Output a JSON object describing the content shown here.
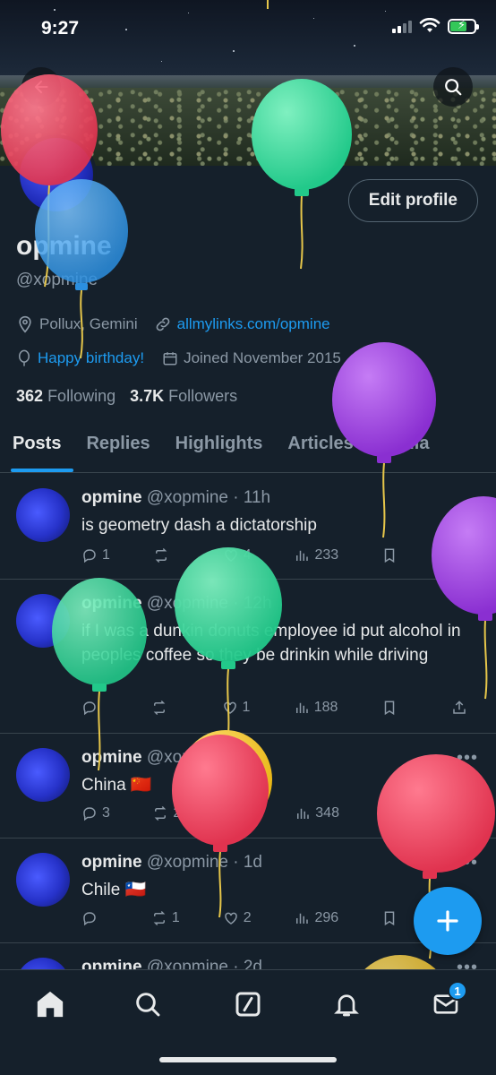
{
  "status_bar": {
    "time": "9:27"
  },
  "profile": {
    "display_name": "opmine",
    "handle": "@xopmine",
    "location": "Pollux, Gemini",
    "website": "allmylinks.com/opmine",
    "birthday": "Happy birthday!",
    "joined": "Joined November 2015",
    "following_count": "362",
    "following_label": "Following",
    "followers_count": "3.7K",
    "followers_label": "Followers",
    "edit_label": "Edit profile"
  },
  "tabs": [
    "Posts",
    "Replies",
    "Highlights",
    "Articles",
    "Media"
  ],
  "tweets": [
    {
      "name": "opmine",
      "sub": "@xopmine · 11h",
      "text": "is geometry dash a dictatorship",
      "replies": "1",
      "retweets": "",
      "likes": "4",
      "views": "233"
    },
    {
      "name": "opmine",
      "sub": "@xopmine · 12h",
      "text": "if I was a dunkin donuts employee id put alcohol in peoples coffee so they be drinkin while driving",
      "replies": "",
      "retweets": "",
      "likes": "1",
      "views": "188"
    },
    {
      "name": "opmine",
      "sub": "@xopmine · 1d",
      "text": "China 🇨🇳",
      "replies": "3",
      "retweets": "2",
      "likes": "5",
      "views": "348"
    },
    {
      "name": "opmine",
      "sub": "@xopmine · 1d",
      "text": "Chile 🇨🇱",
      "replies": "",
      "retweets": "1",
      "likes": "2",
      "views": "296"
    },
    {
      "name": "opmine",
      "sub": "@xopmine · 2d"
    }
  ],
  "nav": {
    "messages_badge": "1"
  },
  "colors": {
    "accent": "#1d9bf0",
    "background": "#15202b",
    "muted": "#8b98a5"
  },
  "icons": [
    "back-arrow-icon",
    "search-icon",
    "location-pin-icon",
    "link-icon",
    "balloon-icon",
    "calendar-icon",
    "reply-icon",
    "retweet-icon",
    "like-icon",
    "views-icon",
    "bookmark-icon",
    "share-icon",
    "home-icon",
    "grok-icon",
    "bell-icon",
    "mail-icon",
    "plus-icon"
  ]
}
